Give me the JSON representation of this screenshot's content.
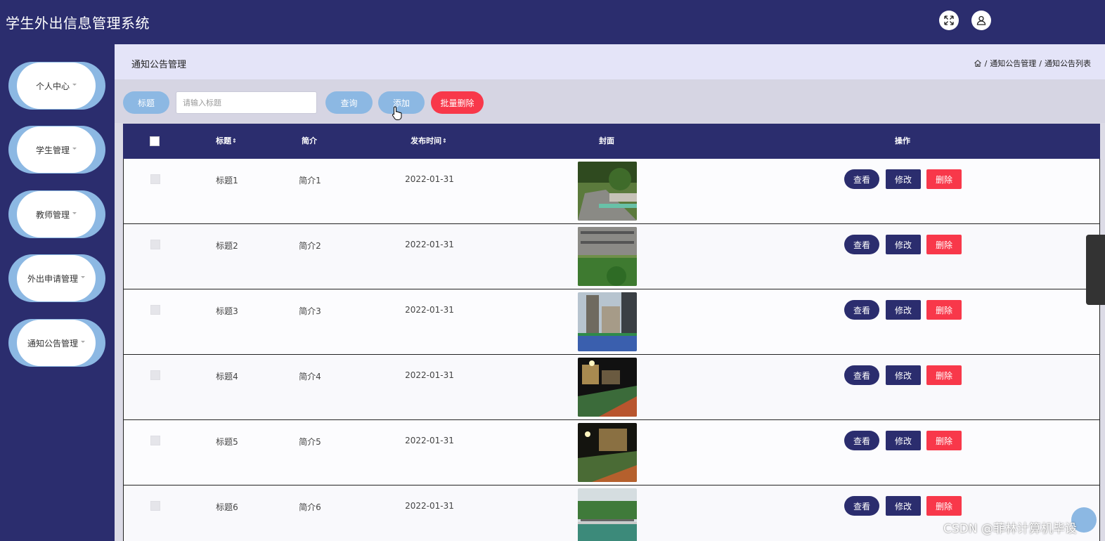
{
  "header": {
    "title": "学生外出信息管理系统"
  },
  "sidebar": {
    "items": [
      {
        "label": "个人中心"
      },
      {
        "label": "学生管理"
      },
      {
        "label": "教师管理"
      },
      {
        "label": "外出申请管理"
      },
      {
        "label": "通知公告管理"
      }
    ]
  },
  "breadcrumb": {
    "page_title": "通知公告管理",
    "separator": "/",
    "level1": "通知公告管理",
    "level2": "通知公告列表"
  },
  "search": {
    "field_label": "标题",
    "placeholder": "请输入标题",
    "value": "",
    "query_label": "查询",
    "add_label": "添加",
    "batch_delete_label": "批量删除"
  },
  "table": {
    "columns": {
      "title": "标题",
      "intro": "简介",
      "publish_time": "发布时间",
      "cover": "封面",
      "actions": "操作"
    },
    "sort_icon": "⇕",
    "actions": {
      "view": "查看",
      "edit": "修改",
      "delete": "删除"
    },
    "rows": [
      {
        "title": "标题1",
        "intro": "简介1",
        "date": "2022-01-31"
      },
      {
        "title": "标题2",
        "intro": "简介2",
        "date": "2022-01-31"
      },
      {
        "title": "标题3",
        "intro": "简介3",
        "date": "2022-01-31"
      },
      {
        "title": "标题4",
        "intro": "简介4",
        "date": "2022-01-31"
      },
      {
        "title": "标题5",
        "intro": "简介5",
        "date": "2022-01-31"
      },
      {
        "title": "标题6",
        "intro": "简介6",
        "date": "2022-01-31"
      }
    ]
  },
  "watermark": "CSDN @菲林计算机毕设",
  "colors": {
    "primary": "#2b2d6e",
    "accent": "#8cb8e3",
    "danger": "#f8384a"
  }
}
